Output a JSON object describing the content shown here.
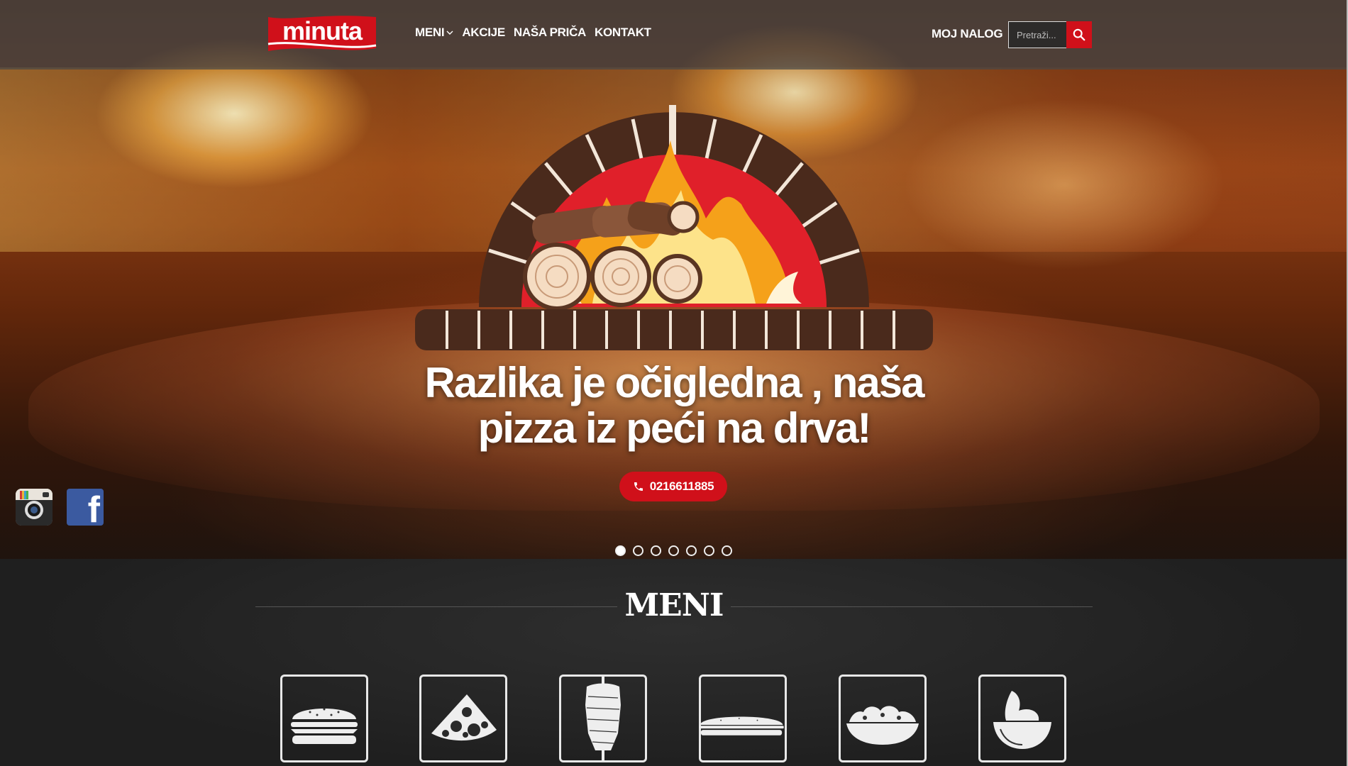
{
  "header": {
    "logo_text": "minuta",
    "nav": [
      {
        "label": "MENI",
        "has_dropdown": true
      },
      {
        "label": "AKCIJE"
      },
      {
        "label": "NAŠA PRIČA"
      },
      {
        "label": "KONTAKT"
      }
    ],
    "account_label": "MOJ NALOG",
    "search_placeholder": "Pretraži..."
  },
  "hero": {
    "tagline_line1": "Razlika je očigledna , naša",
    "tagline_line2": "pizza iz peći na drva!",
    "phone": "0216611885",
    "slides_total": 7,
    "active_slide": 1
  },
  "social": [
    {
      "name": "instagram-icon"
    },
    {
      "name": "facebook-icon",
      "glyph": "f"
    }
  ],
  "menu": {
    "title": "MENI",
    "categories": [
      {
        "icon": "burger-icon"
      },
      {
        "icon": "pizza-slice-icon"
      },
      {
        "icon": "gyros-icon"
      },
      {
        "icon": "sandwich-icon"
      },
      {
        "icon": "salad-icon"
      },
      {
        "icon": "sauce-icon"
      }
    ]
  },
  "colors": {
    "accent": "#d0101a",
    "header_bg": "#464646",
    "section_bg": "#262626",
    "oven_brick": "#4a2a1c",
    "oven_fire_red": "#e0202a",
    "oven_fire_orange": "#f5a11a"
  }
}
